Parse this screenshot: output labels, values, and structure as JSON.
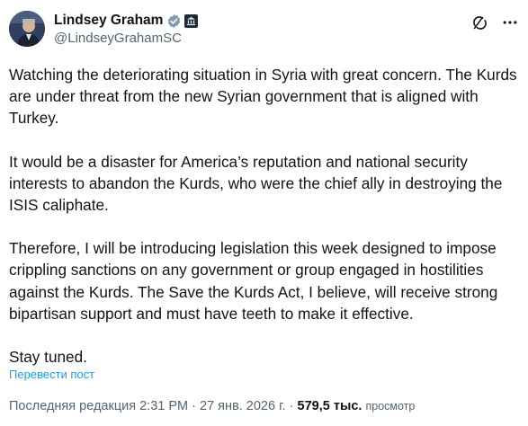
{
  "author": {
    "display_name": "Lindsey Graham",
    "handle": "@LindseyGrahamSC"
  },
  "tweet": {
    "paragraphs": [
      "Watching the deteriorating situation in Syria with great concern. The Kurds are under threat from the new Syrian government that is aligned with Turkey.",
      "It would be a disaster for America’s reputation and national security interests to abandon the Kurds, who were the chief ally in destroying the ISIS caliphate.",
      "Therefore, I will be introducing legislation this week designed to impose crippling sanctions on any government or group engaged in hostilities against the Kurds. The Save the Kurds Act, I believe, will receive strong bipartisan support and must have teeth to make it effective.",
      "Stay tuned."
    ],
    "translate_label": "Перевести пост"
  },
  "meta": {
    "edited_prefix": "Последняя редакция",
    "time": "2:31 PM",
    "separator": "·",
    "date": "27 янв. 2026 г.",
    "views_count": "579,5 тыс.",
    "views_label": "просмотр"
  },
  "icons": {
    "verified": "verified-badge-icon",
    "government": "government-badge-icon",
    "grok": "grok-icon",
    "more": "more-icon"
  },
  "colors": {
    "verified_gray": "#829aab",
    "link_blue": "#1d9bf0",
    "muted_text": "#536471",
    "main_text": "#0f1419"
  }
}
